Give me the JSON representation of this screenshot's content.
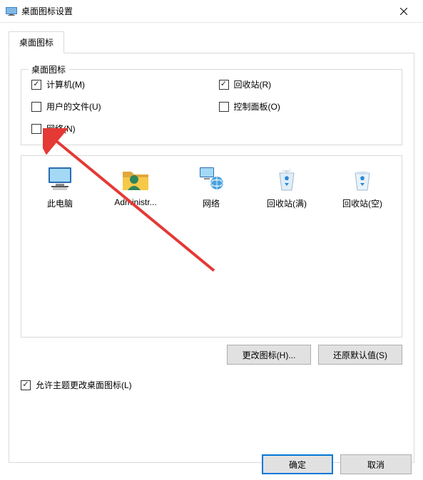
{
  "titlebar": {
    "title": "桌面图标设置"
  },
  "tabs": {
    "desktop_icons": "桌面图标"
  },
  "group": {
    "label": "桌面图标",
    "checkboxes": {
      "computer": {
        "label": "计算机(M)",
        "checked": true
      },
      "recycle_bin": {
        "label": "回收站(R)",
        "checked": true
      },
      "user_files": {
        "label": "用户的文件(U)",
        "checked": false
      },
      "control_panel": {
        "label": "控制面板(O)",
        "checked": false
      },
      "network": {
        "label": "网络(N)",
        "checked": false
      }
    }
  },
  "icons": {
    "this_pc": "此电脑",
    "admin": "Administr...",
    "network": "网络",
    "recycle_full": "回收站(满)",
    "recycle_empty": "回收站(空)"
  },
  "buttons": {
    "change_icon": "更改图标(H)...",
    "restore_default": "还原默认值(S)",
    "ok": "确定",
    "cancel": "取消"
  },
  "allow_themes": {
    "label": "允许主题更改桌面图标(L)",
    "checked": true
  }
}
